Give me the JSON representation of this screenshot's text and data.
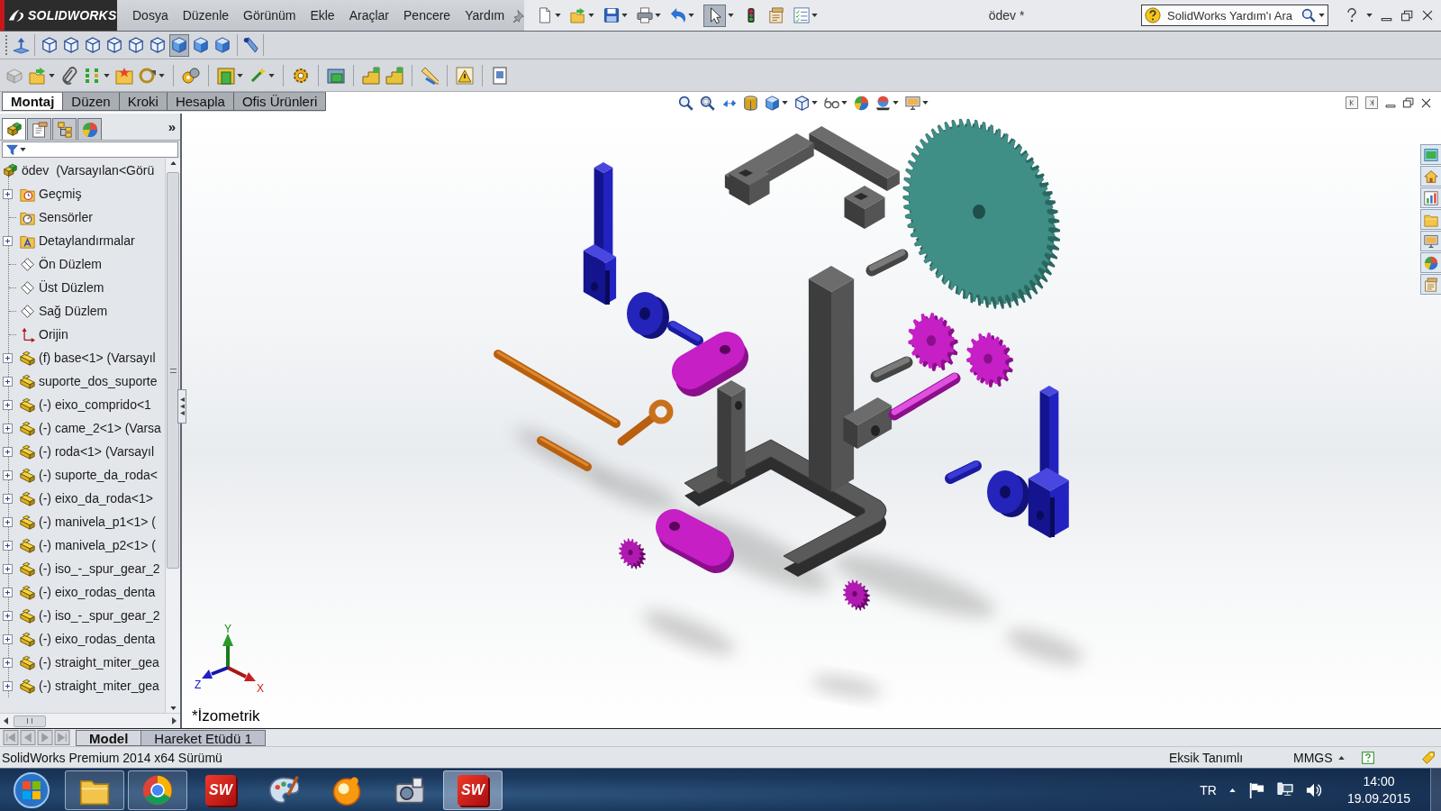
{
  "title_bar": {
    "logo": "SOLIDWORKS",
    "menu": [
      "Dosya",
      "Düzenle",
      "Görünüm",
      "Ekle",
      "Araçlar",
      "Pencere",
      "Yardım"
    ],
    "select_tool": {
      "selected": true
    },
    "document_title": "ödev *",
    "help_search": {
      "placeholder": "SolidWorks Yardım'ı Ara"
    }
  },
  "view_toolbar": [
    {
      "selected": false
    },
    {
      "selected": false
    },
    {
      "selected": false
    },
    {
      "selected": false
    },
    {
      "selected": false
    },
    {
      "selected": false
    },
    {
      "selected": true
    },
    {
      "selected": false
    },
    {
      "selected": false
    }
  ],
  "command_tabs": [
    {
      "label": "Montaj",
      "selected": true
    },
    {
      "label": "Düzen",
      "selected": false
    },
    {
      "label": "Kroki",
      "selected": false
    },
    {
      "label": "Hesapla",
      "selected": false
    },
    {
      "label": "Ofis Ürünleri",
      "selected": false
    }
  ],
  "feature_manager": {
    "panel_tabs": [
      {
        "selected": true
      },
      {
        "selected": false
      },
      {
        "selected": false
      },
      {
        "selected": false
      }
    ],
    "more": "»",
    "tree": {
      "label": "ödev  (Varsayılan<Görü",
      "kind": "assembly",
      "children": [
        {
          "label": "Geçmiş",
          "kind": "history",
          "expanded": false
        },
        {
          "label": "Sensörler",
          "kind": "sensors"
        },
        {
          "label": "Detaylandırmalar",
          "kind": "annotations",
          "expanded": false
        },
        {
          "label": "Ön Düzlem",
          "kind": "plane"
        },
        {
          "label": "Üst Düzlem",
          "kind": "plane"
        },
        {
          "label": "Sağ Düzlem",
          "kind": "plane"
        },
        {
          "label": "Orijin",
          "kind": "origin"
        },
        {
          "label": "(f) base<1> (Varsayıl",
          "kind": "component",
          "expanded": false
        },
        {
          "label": "suporte_dos_suporte",
          "kind": "component",
          "expanded": false
        },
        {
          "label": "(-) eixo_comprido<1",
          "kind": "component",
          "expanded": false
        },
        {
          "label": "(-) came_2<1> (Varsa",
          "kind": "component",
          "expanded": false
        },
        {
          "label": "(-) roda<1> (Varsayıl",
          "kind": "component",
          "expanded": false
        },
        {
          "label": "(-) suporte_da_roda<",
          "kind": "component",
          "expanded": false
        },
        {
          "label": "(-) eixo_da_roda<1>",
          "kind": "component",
          "expanded": false
        },
        {
          "label": "(-) manivela_p1<1> (",
          "kind": "component",
          "expanded": false
        },
        {
          "label": "(-) manivela_p2<1> (",
          "kind": "component",
          "expanded": false
        },
        {
          "label": "(-) iso_-_spur_gear_2",
          "kind": "component",
          "expanded": false
        },
        {
          "label": "(-) eixo_rodas_denta",
          "kind": "component",
          "expanded": false
        },
        {
          "label": "(-) iso_-_spur_gear_2",
          "kind": "component",
          "expanded": false
        },
        {
          "label": "(-) eixo_rodas_denta",
          "kind": "component",
          "expanded": false
        },
        {
          "label": "(-) straight_miter_gea",
          "kind": "component",
          "expanded": false
        },
        {
          "label": "(-) straight_miter_gea",
          "kind": "component",
          "expanded": false
        }
      ]
    }
  },
  "viewport": {
    "view_name": "*İzometrik",
    "triad": {
      "x": "X",
      "y": "Y",
      "z": "Z"
    }
  },
  "bottom_tabs": [
    {
      "label": "Model",
      "selected": true
    },
    {
      "label": "Hareket Etüdü 1",
      "selected": false
    }
  ],
  "status_bar": {
    "version": "SolidWorks Premium 2014 x64 Sürümü",
    "status": "Eksik Tanımlı",
    "units": "MMGS"
  },
  "taskbar": {
    "apps": [
      {
        "running": true,
        "active": false
      },
      {
        "running": true,
        "active": false
      },
      {
        "label": "SW",
        "running": false,
        "active": false
      },
      {
        "running": false,
        "active": false
      },
      {
        "running": false,
        "active": false
      },
      {
        "running": false,
        "active": false
      },
      {
        "label": "SW",
        "running": true,
        "active": true
      }
    ],
    "language": "TR",
    "time": "14:00",
    "date": "19.09.2015"
  }
}
